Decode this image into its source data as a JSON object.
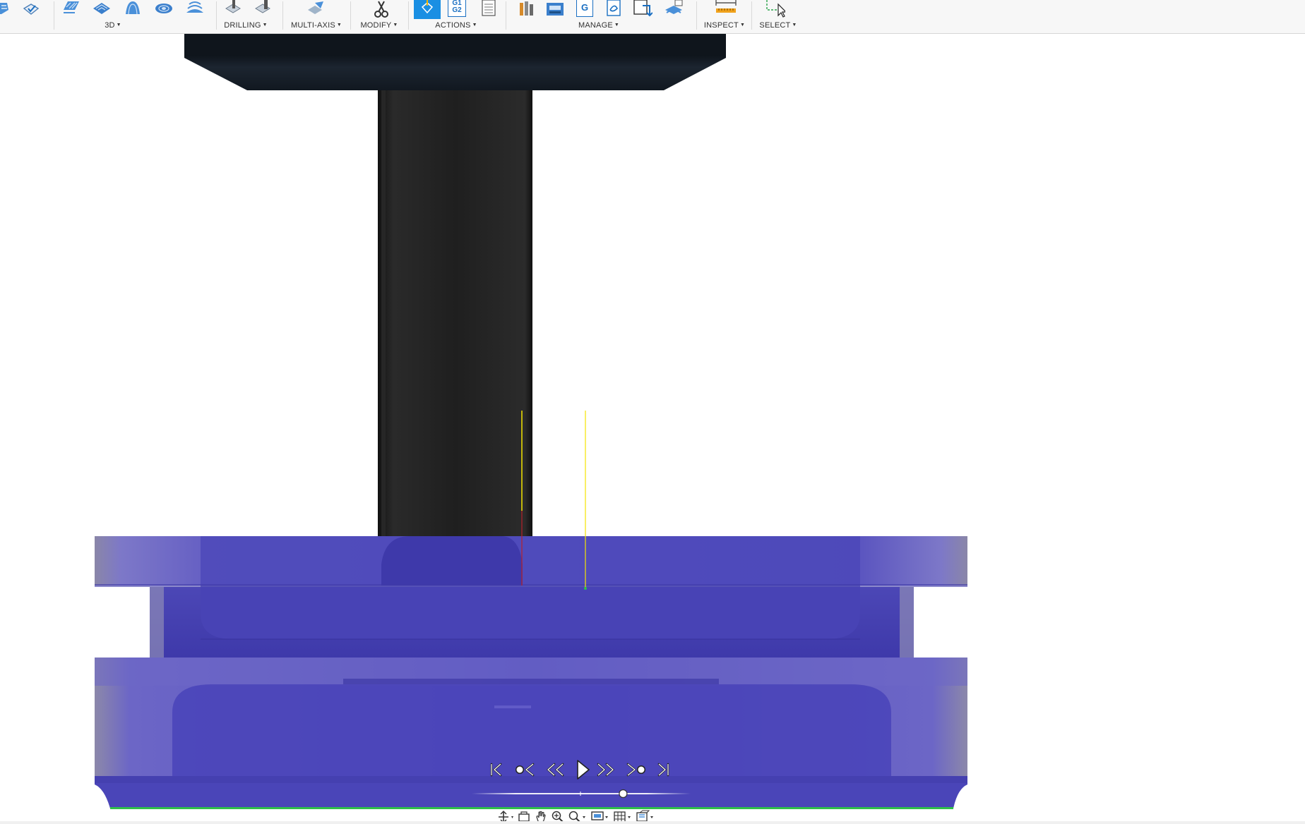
{
  "toolbar": {
    "groups": {
      "threed": {
        "label": "3D"
      },
      "drilling": {
        "label": "DRILLING"
      },
      "multiaxis": {
        "label": "MULTI-AXIS"
      },
      "modify": {
        "label": "MODIFY"
      },
      "actions": {
        "label": "ACTIONS"
      },
      "manage": {
        "label": "MANAGE"
      },
      "inspect": {
        "label": "INSPECT"
      },
      "select": {
        "label": "SELECT"
      }
    },
    "actions_icons": {
      "g1g2_line1": "G1",
      "g1g2_line2": "G2"
    },
    "manage_icons": {
      "g_letter": "G"
    },
    "caret": "▾"
  },
  "colors": {
    "toolbar_bg": "#f7f7f7",
    "accent_blue": "#1a8fe3",
    "stock_purple": "#4a45b8",
    "stock_light": "#6e68c8",
    "tool_shank": "#1e1e1e",
    "tool_holder": "#151b22",
    "toolpath_yellow": "#f5e400",
    "stock_edge_green": "#2fbf4a"
  },
  "simulation": {
    "controls": [
      "skip-to-start",
      "previous-operation",
      "step-back",
      "play",
      "step-forward",
      "next-operation",
      "skip-to-end"
    ],
    "progress": 0.72
  }
}
